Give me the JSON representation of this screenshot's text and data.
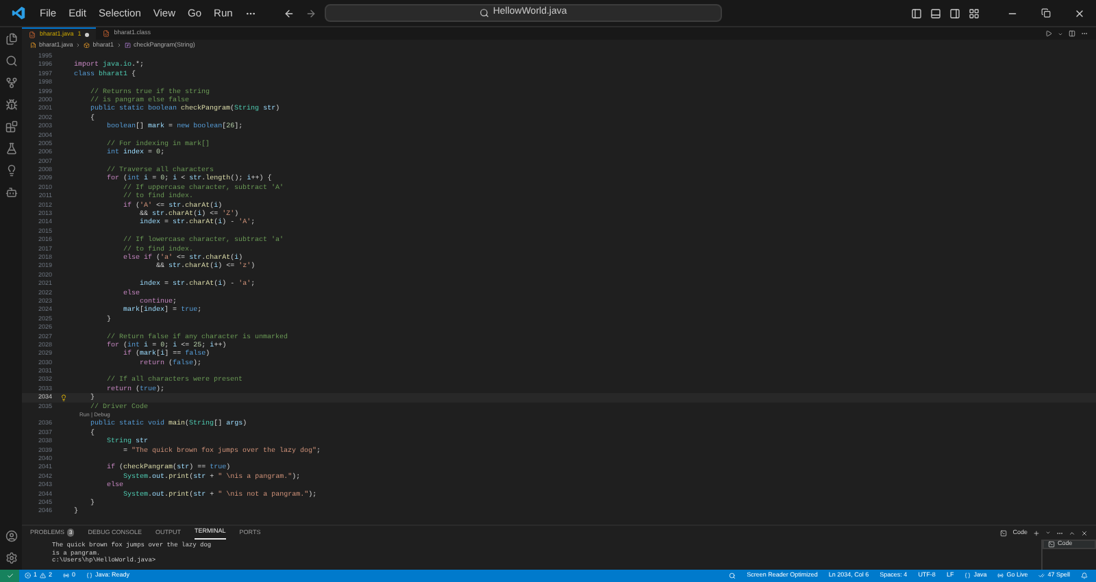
{
  "menu": [
    "File",
    "Edit",
    "Selection",
    "View",
    "Go",
    "Run"
  ],
  "command_center": {
    "text": "HellowWorld.java"
  },
  "tabs": [
    {
      "label": "bharat1.java",
      "badge": "1",
      "modified": true,
      "selected": true
    },
    {
      "label": "bharat1.class",
      "modified": false,
      "selected": false
    }
  ],
  "breadcrumb": [
    {
      "kind": "file",
      "text": "bharat1.java"
    },
    {
      "kind": "class",
      "text": "bharat1"
    },
    {
      "kind": "method",
      "text": "checkPangram(String)"
    }
  ],
  "editor": {
    "codelens": "Run | Debug",
    "lines": [
      {
        "number": "1995",
        "current": false
      },
      {
        "number": "1996",
        "current": false,
        "segments": [
          {
            "kind": "ctl",
            "text": "import "
          },
          {
            "kind": "type",
            "text": "java.io"
          },
          {
            "kind": "pl",
            "text": ".*;"
          }
        ]
      },
      {
        "number": "1997",
        "current": false,
        "segments": [
          {
            "kind": "kw",
            "text": "class "
          },
          {
            "kind": "type",
            "text": "bharat1"
          },
          {
            "kind": "pl",
            "text": " {"
          }
        ]
      },
      {
        "number": "1998",
        "current": false
      },
      {
        "number": "1999",
        "current": false,
        "segments": [
          {
            "kind": "cmt",
            "text": "    // Returns true if the string"
          }
        ]
      },
      {
        "number": "2000",
        "current": false,
        "segments": [
          {
            "kind": "cmt",
            "text": "    // is pangram else false"
          }
        ]
      },
      {
        "number": "2001",
        "current": false,
        "segments": [
          {
            "kind": "kw",
            "text": "    public static boolean "
          },
          {
            "kind": "fn",
            "text": "checkPangram"
          },
          {
            "kind": "pl",
            "text": "("
          },
          {
            "kind": "type",
            "text": "String "
          },
          {
            "kind": "var",
            "text": "str"
          },
          {
            "kind": "pl",
            "text": ")"
          }
        ]
      },
      {
        "number": "2002",
        "current": false,
        "segments": [
          {
            "kind": "pl",
            "text": "    {"
          }
        ]
      },
      {
        "number": "2003",
        "current": false,
        "segments": [
          {
            "kind": "kw",
            "text": "        boolean"
          },
          {
            "kind": "pl",
            "text": "[] "
          },
          {
            "kind": "var",
            "text": "mark"
          },
          {
            "kind": "pl",
            "text": " = "
          },
          {
            "kind": "kw",
            "text": "new boolean"
          },
          {
            "kind": "pl",
            "text": "["
          },
          {
            "kind": "num",
            "text": "26"
          },
          {
            "kind": "pl",
            "text": "];"
          }
        ]
      },
      {
        "number": "2004",
        "current": false
      },
      {
        "number": "2005",
        "current": false,
        "segments": [
          {
            "kind": "cmt",
            "text": "        // For indexing in mark[]"
          }
        ]
      },
      {
        "number": "2006",
        "current": false,
        "segments": [
          {
            "kind": "kw",
            "text": "        int "
          },
          {
            "kind": "var",
            "text": "index"
          },
          {
            "kind": "pl",
            "text": " = "
          },
          {
            "kind": "num",
            "text": "0"
          },
          {
            "kind": "pl",
            "text": ";"
          }
        ]
      },
      {
        "number": "2007",
        "current": false
      },
      {
        "number": "2008",
        "current": false,
        "segments": [
          {
            "kind": "cmt",
            "text": "        // Traverse all characters"
          }
        ]
      },
      {
        "number": "2009",
        "current": false,
        "segments": [
          {
            "kind": "ctl",
            "text": "        for "
          },
          {
            "kind": "pl",
            "text": "("
          },
          {
            "kind": "kw",
            "text": "int "
          },
          {
            "kind": "var",
            "text": "i"
          },
          {
            "kind": "pl",
            "text": " = "
          },
          {
            "kind": "num",
            "text": "0"
          },
          {
            "kind": "pl",
            "text": "; "
          },
          {
            "kind": "var",
            "text": "i"
          },
          {
            "kind": "pl",
            "text": " < "
          },
          {
            "kind": "var",
            "text": "str"
          },
          {
            "kind": "pl",
            "text": "."
          },
          {
            "kind": "fn",
            "text": "length"
          },
          {
            "kind": "pl",
            "text": "(); "
          },
          {
            "kind": "var",
            "text": "i"
          },
          {
            "kind": "pl",
            "text": "++) {"
          }
        ]
      },
      {
        "number": "2010",
        "current": false,
        "segments": [
          {
            "kind": "cmt",
            "text": "            // If uppercase character, subtract 'A'"
          }
        ]
      },
      {
        "number": "2011",
        "current": false,
        "segments": [
          {
            "kind": "cmt",
            "text": "            // to find index."
          }
        ]
      },
      {
        "number": "2012",
        "current": false,
        "segments": [
          {
            "kind": "ctl",
            "text": "            if "
          },
          {
            "kind": "pl",
            "text": "("
          },
          {
            "kind": "str",
            "text": "'A'"
          },
          {
            "kind": "pl",
            "text": " <= "
          },
          {
            "kind": "var",
            "text": "str"
          },
          {
            "kind": "pl",
            "text": "."
          },
          {
            "kind": "fn",
            "text": "charAt"
          },
          {
            "kind": "pl",
            "text": "("
          },
          {
            "kind": "var",
            "text": "i"
          },
          {
            "kind": "pl",
            "text": ")"
          }
        ]
      },
      {
        "number": "2013",
        "current": false,
        "segments": [
          {
            "kind": "pl",
            "text": "                && "
          },
          {
            "kind": "var",
            "text": "str"
          },
          {
            "kind": "pl",
            "text": "."
          },
          {
            "kind": "fn",
            "text": "charAt"
          },
          {
            "kind": "pl",
            "text": "("
          },
          {
            "kind": "var",
            "text": "i"
          },
          {
            "kind": "pl",
            "text": ") <= "
          },
          {
            "kind": "str",
            "text": "'Z'"
          },
          {
            "kind": "pl",
            "text": ")"
          }
        ]
      },
      {
        "number": "2014",
        "current": false,
        "segments": [
          {
            "kind": "var",
            "text": "                index"
          },
          {
            "kind": "pl",
            "text": " = "
          },
          {
            "kind": "var",
            "text": "str"
          },
          {
            "kind": "pl",
            "text": "."
          },
          {
            "kind": "fn",
            "text": "charAt"
          },
          {
            "kind": "pl",
            "text": "("
          },
          {
            "kind": "var",
            "text": "i"
          },
          {
            "kind": "pl",
            "text": ") - "
          },
          {
            "kind": "str",
            "text": "'A'"
          },
          {
            "kind": "pl",
            "text": ";"
          }
        ]
      },
      {
        "number": "2015",
        "current": false
      },
      {
        "number": "2016",
        "current": false,
        "segments": [
          {
            "kind": "cmt",
            "text": "            // If lowercase character, subtract 'a'"
          }
        ]
      },
      {
        "number": "2017",
        "current": false,
        "segments": [
          {
            "kind": "cmt",
            "text": "            // to find index."
          }
        ]
      },
      {
        "number": "2018",
        "current": false,
        "segments": [
          {
            "kind": "ctl",
            "text": "            else if "
          },
          {
            "kind": "pl",
            "text": "("
          },
          {
            "kind": "str",
            "text": "'a'"
          },
          {
            "kind": "pl",
            "text": " <= "
          },
          {
            "kind": "var",
            "text": "str"
          },
          {
            "kind": "pl",
            "text": "."
          },
          {
            "kind": "fn",
            "text": "charAt"
          },
          {
            "kind": "pl",
            "text": "("
          },
          {
            "kind": "var",
            "text": "i"
          },
          {
            "kind": "pl",
            "text": ")"
          }
        ]
      },
      {
        "number": "2019",
        "current": false,
        "segments": [
          {
            "kind": "pl",
            "text": "                    && "
          },
          {
            "kind": "var",
            "text": "str"
          },
          {
            "kind": "pl",
            "text": "."
          },
          {
            "kind": "fn",
            "text": "charAt"
          },
          {
            "kind": "pl",
            "text": "("
          },
          {
            "kind": "var",
            "text": "i"
          },
          {
            "kind": "pl",
            "text": ") <= "
          },
          {
            "kind": "str",
            "text": "'z'"
          },
          {
            "kind": "pl",
            "text": ")"
          }
        ]
      },
      {
        "number": "2020",
        "current": false
      },
      {
        "number": "2021",
        "current": false,
        "segments": [
          {
            "kind": "var",
            "text": "                index"
          },
          {
            "kind": "pl",
            "text": " = "
          },
          {
            "kind": "var",
            "text": "str"
          },
          {
            "kind": "pl",
            "text": "."
          },
          {
            "kind": "fn",
            "text": "charAt"
          },
          {
            "kind": "pl",
            "text": "("
          },
          {
            "kind": "var",
            "text": "i"
          },
          {
            "kind": "pl",
            "text": ") - "
          },
          {
            "kind": "str",
            "text": "'a'"
          },
          {
            "kind": "pl",
            "text": ";"
          }
        ]
      },
      {
        "number": "2022",
        "current": false,
        "segments": [
          {
            "kind": "ctl",
            "text": "            else"
          }
        ]
      },
      {
        "number": "2023",
        "current": false,
        "segments": [
          {
            "kind": "ctl",
            "text": "                continue"
          },
          {
            "kind": "pl",
            "text": ";"
          }
        ]
      },
      {
        "number": "2024",
        "current": false,
        "segments": [
          {
            "kind": "var",
            "text": "            mark"
          },
          {
            "kind": "pl",
            "text": "["
          },
          {
            "kind": "var",
            "text": "index"
          },
          {
            "kind": "pl",
            "text": "] = "
          },
          {
            "kind": "kw",
            "text": "true"
          },
          {
            "kind": "pl",
            "text": ";"
          }
        ]
      },
      {
        "number": "2025",
        "current": false,
        "segments": [
          {
            "kind": "pl",
            "text": "        }"
          }
        ]
      },
      {
        "number": "2026",
        "current": false
      },
      {
        "number": "2027",
        "current": false,
        "segments": [
          {
            "kind": "cmt",
            "text": "        // Return false if any character is unmarked"
          }
        ]
      },
      {
        "number": "2028",
        "current": false,
        "segments": [
          {
            "kind": "ctl",
            "text": "        for "
          },
          {
            "kind": "pl",
            "text": "("
          },
          {
            "kind": "kw",
            "text": "int "
          },
          {
            "kind": "var",
            "text": "i"
          },
          {
            "kind": "pl",
            "text": " = "
          },
          {
            "kind": "num",
            "text": "0"
          },
          {
            "kind": "pl",
            "text": "; "
          },
          {
            "kind": "var",
            "text": "i"
          },
          {
            "kind": "pl",
            "text": " <= "
          },
          {
            "kind": "num",
            "text": "25"
          },
          {
            "kind": "pl",
            "text": "; "
          },
          {
            "kind": "var",
            "text": "i"
          },
          {
            "kind": "pl",
            "text": "++)"
          }
        ]
      },
      {
        "number": "2029",
        "current": false,
        "segments": [
          {
            "kind": "ctl",
            "text": "            if "
          },
          {
            "kind": "pl",
            "text": "("
          },
          {
            "kind": "var",
            "text": "mark"
          },
          {
            "kind": "pl",
            "text": "["
          },
          {
            "kind": "var",
            "text": "i"
          },
          {
            "kind": "pl",
            "text": "] == "
          },
          {
            "kind": "kw",
            "text": "false"
          },
          {
            "kind": "pl",
            "text": ")"
          }
        ]
      },
      {
        "number": "2030",
        "current": false,
        "segments": [
          {
            "kind": "ctl",
            "text": "                return "
          },
          {
            "kind": "pl",
            "text": "("
          },
          {
            "kind": "kw",
            "text": "false"
          },
          {
            "kind": "pl",
            "text": ");"
          }
        ]
      },
      {
        "number": "2031",
        "current": false
      },
      {
        "number": "2032",
        "current": false,
        "segments": [
          {
            "kind": "cmt",
            "text": "        // If all characters were present"
          }
        ]
      },
      {
        "number": "2033",
        "current": false,
        "segments": [
          {
            "kind": "ctl",
            "text": "        return "
          },
          {
            "kind": "pl",
            "text": "("
          },
          {
            "kind": "kw",
            "text": "true"
          },
          {
            "kind": "pl",
            "text": ");"
          }
        ]
      },
      {
        "number": "2034",
        "current": true,
        "segments": [
          {
            "kind": "pl",
            "text": "    }"
          }
        ]
      },
      {
        "number": "2035",
        "current": false,
        "segments": [
          {
            "kind": "cmt",
            "text": "    // Driver Code"
          }
        ]
      },
      {
        "number": "2036",
        "current": false,
        "codelens": true,
        "segments": [
          {
            "kind": "kw",
            "text": "    public static void "
          },
          {
            "kind": "fn",
            "text": "main"
          },
          {
            "kind": "pl",
            "text": "("
          },
          {
            "kind": "type",
            "text": "String"
          },
          {
            "kind": "pl",
            "text": "[] "
          },
          {
            "kind": "var",
            "text": "args"
          },
          {
            "kind": "pl",
            "text": ")"
          }
        ]
      },
      {
        "number": "2037",
        "current": false,
        "segments": [
          {
            "kind": "pl",
            "text": "    {"
          }
        ]
      },
      {
        "number": "2038",
        "current": false,
        "segments": [
          {
            "kind": "type",
            "text": "        String "
          },
          {
            "kind": "var",
            "text": "str"
          }
        ]
      },
      {
        "number": "2039",
        "current": false,
        "segments": [
          {
            "kind": "pl",
            "text": "            = "
          },
          {
            "kind": "str",
            "text": "\"The quick brown fox jumps over the lazy dog\""
          },
          {
            "kind": "pl",
            "text": ";"
          }
        ]
      },
      {
        "number": "2040",
        "current": false
      },
      {
        "number": "2041",
        "current": false,
        "segments": [
          {
            "kind": "ctl",
            "text": "        if "
          },
          {
            "kind": "pl",
            "text": "("
          },
          {
            "kind": "fn",
            "text": "checkPangram"
          },
          {
            "kind": "pl",
            "text": "("
          },
          {
            "kind": "var",
            "text": "str"
          },
          {
            "kind": "pl",
            "text": ") == "
          },
          {
            "kind": "kw",
            "text": "true"
          },
          {
            "kind": "pl",
            "text": ")"
          }
        ]
      },
      {
        "number": "2042",
        "current": false,
        "segments": [
          {
            "kind": "type",
            "text": "            System"
          },
          {
            "kind": "pl",
            "text": "."
          },
          {
            "kind": "var",
            "text": "out"
          },
          {
            "kind": "pl",
            "text": "."
          },
          {
            "kind": "fn",
            "text": "print"
          },
          {
            "kind": "pl",
            "text": "("
          },
          {
            "kind": "var",
            "text": "str"
          },
          {
            "kind": "pl",
            "text": " + "
          },
          {
            "kind": "str",
            "text": "\" \\nis a pangram.\""
          },
          {
            "kind": "pl",
            "text": ");"
          }
        ]
      },
      {
        "number": "2043",
        "current": false,
        "segments": [
          {
            "kind": "ctl",
            "text": "        else"
          }
        ]
      },
      {
        "number": "2044",
        "current": false,
        "segments": [
          {
            "kind": "type",
            "text": "            System"
          },
          {
            "kind": "pl",
            "text": "."
          },
          {
            "kind": "var",
            "text": "out"
          },
          {
            "kind": "pl",
            "text": "."
          },
          {
            "kind": "fn",
            "text": "print"
          },
          {
            "kind": "pl",
            "text": "("
          },
          {
            "kind": "var",
            "text": "str"
          },
          {
            "kind": "pl",
            "text": " + "
          },
          {
            "kind": "str",
            "text": "\" \\nis not a pangram.\""
          },
          {
            "kind": "pl",
            "text": ");"
          }
        ]
      },
      {
        "number": "2045",
        "current": false,
        "segments": [
          {
            "kind": "pl",
            "text": "    }"
          }
        ]
      },
      {
        "number": "2046",
        "current": false,
        "segments": [
          {
            "kind": "pl",
            "text": "}"
          }
        ]
      }
    ]
  },
  "panel": {
    "tabs": [
      {
        "label": "PROBLEMS",
        "badge": "3",
        "selected": false
      },
      {
        "label": "DEBUG CONSOLE",
        "selected": false
      },
      {
        "label": "OUTPUT",
        "selected": false
      },
      {
        "label": "TERMINAL",
        "selected": true
      },
      {
        "label": "PORTS",
        "selected": false
      }
    ],
    "terminal_name": "Code",
    "terminal_lines": [
      "The quick brown fox jumps over the lazy dog",
      "is a pangram.",
      "c:\\Users\\hp\\HelloWorld.java>"
    ],
    "terminal_list": [
      "Code"
    ]
  },
  "status_bar": {
    "errors": "1",
    "warnings": "2",
    "ports": "0",
    "java": "Java: Ready",
    "right": [
      {
        "kind": "plain",
        "text": "Screen Reader Optimized"
      },
      {
        "kind": "plain",
        "text": "Ln 2034, Col 6"
      },
      {
        "kind": "plain",
        "text": "Spaces: 4"
      },
      {
        "kind": "plain",
        "text": "UTF-8"
      },
      {
        "kind": "plain",
        "text": "LF"
      },
      {
        "kind": "braces",
        "text": "Java"
      },
      {
        "kind": "broadcast",
        "text": "Go Live"
      },
      {
        "kind": "spell",
        "text": "47 Spell"
      }
    ]
  }
}
